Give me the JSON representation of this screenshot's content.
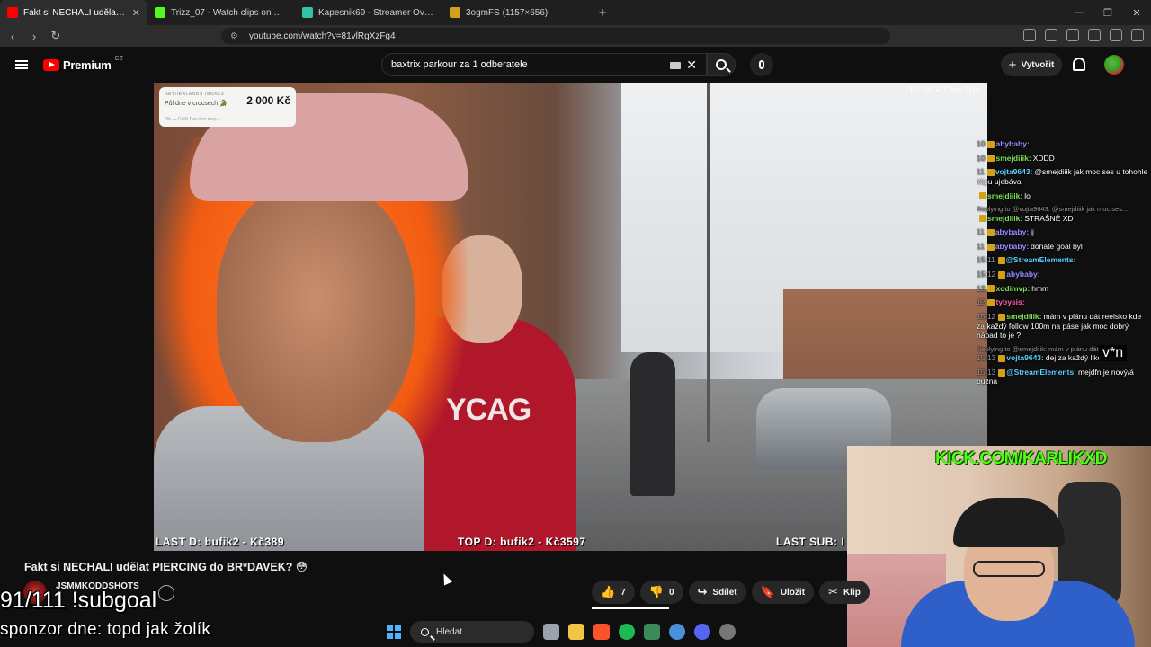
{
  "browser": {
    "tabs": [
      {
        "title": "Fakt si NECHALI udělat PIERC",
        "favicon_color": "#ff0000",
        "active": true
      },
      {
        "title": "Trizz_07 - Watch clips on Kick",
        "favicon_color": "#53fc18",
        "active": false
      },
      {
        "title": "Kapesnik69 - Streamer Overview & S",
        "favicon_color": "#2ec4a6",
        "active": false
      },
      {
        "title": "3ogmFS (1157×656)",
        "favicon_color": "#d4a017",
        "active": false
      }
    ],
    "url": "youtube.com/watch?v=81vlRgXzFg4"
  },
  "youtube": {
    "logo": "Premium",
    "country": "CZ",
    "search_value": "baxtrix parkour za 1 odberatele",
    "create_label": "Vytvořit"
  },
  "video": {
    "goal_overlay": {
      "label": "NETHERLANDS IGOALS",
      "goal_text": "Půl dne v crocsech 🐊",
      "amount": "2 000 Kč",
      "footer": "0% — Další Den bez map ○"
    },
    "bottom_overlay": {
      "last_d": "LAST D: bufik2 - Kč389",
      "top_d": "TOP D: bufik2 - Kč3597",
      "last_sub": "LAST SUB: I"
    },
    "timestamp": "12:09 • 73m 20s",
    "chat": [
      {
        "ts": "10",
        "user": "abybaby:",
        "user_color": "#9b8cff",
        "text": ""
      },
      {
        "ts": "10",
        "user": "smejdiiik:",
        "user_color": "#7fe05a",
        "text": "XDDD"
      },
      {
        "ts": "11",
        "user": "vojta9643:",
        "user_color": "#5fd0ff",
        "text": "@smejdiiik jak moc ses u tohohle klipu ujebával"
      },
      {
        "ts": "",
        "user": "smejdiiik:",
        "user_color": "#7fe05a",
        "text": "lo"
      },
      {
        "ts": "",
        "user": "smejdiiik:",
        "user_color": "#7fe05a",
        "text": "STRAŠNÉ XD",
        "reply": "Replying to @vojta9643: @smejdiiik jak moc ses..."
      },
      {
        "ts": "11",
        "user": "abybaby:",
        "user_color": "#9b8cff",
        "text": "jj"
      },
      {
        "ts": "11",
        "user": "abybaby:",
        "user_color": "#9b8cff",
        "text": "donate goal byl"
      },
      {
        "ts": "15:11",
        "user": "@StreamElements:",
        "user_color": "#5fd0ff",
        "text": ""
      },
      {
        "ts": "15:12",
        "user": "abybaby:",
        "user_color": "#9b8cff",
        "text": ""
      },
      {
        "ts": "12",
        "user": "xodimvp:",
        "user_color": "#7fe05a",
        "text": "hmm"
      },
      {
        "ts": "12",
        "user": "tybysis:",
        "user_color": "#ff5fa8",
        "text": ""
      },
      {
        "ts": "15:12",
        "user": "smejdiiik:",
        "user_color": "#7fe05a",
        "text": "mám v plánu dát reelsko kde za každý follow 100m na páse jak moc dobrý nápad to je ?"
      },
      {
        "ts": "15:13",
        "user": "vojta9643:",
        "user_color": "#5fd0ff",
        "text": "dej za každý like 10m",
        "reply": "Replying to @smejdiiik: mám v plánu dát ven r..."
      },
      {
        "ts": "15:13",
        "user": "@StreamElements:",
        "user_color": "#5fd0ff",
        "text": "mejdfn je nový/á buzna"
      }
    ],
    "vn_text": "v*n",
    "kick_url": "KICK.COM/KARLIKXD"
  },
  "info": {
    "title": "Fakt si NECHALI udělat PIERCING do BR*DAVEK? 😳",
    "channel": "JSMMKODDSHOTS",
    "likes": "7",
    "dislikes": "0",
    "share": "Sdílet",
    "save": "Uložit",
    "clip": "Klip"
  },
  "stream_overlay": {
    "subgoal": "91/111 !subgoal",
    "sponzor": "sponzor dne: topd jak žolík"
  },
  "taskbar": {
    "search_label": "Hledat"
  }
}
